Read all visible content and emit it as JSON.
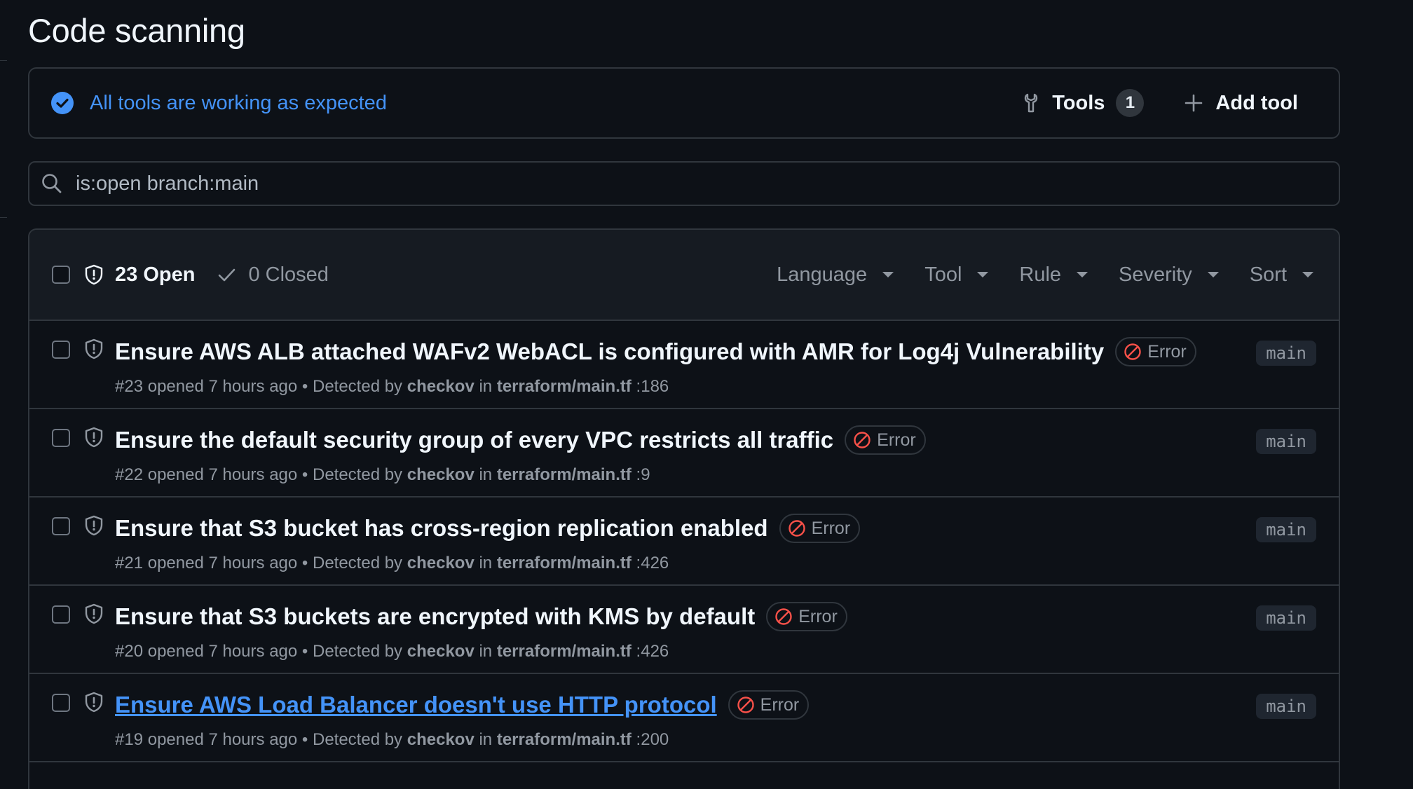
{
  "page": {
    "title": "Code scanning"
  },
  "status": {
    "message": "All tools are working as expected",
    "tools_label": "Tools",
    "tools_count": "1",
    "add_tool_label": "Add tool"
  },
  "search": {
    "value": "is:open branch:main"
  },
  "list_header": {
    "open_label": "23 Open",
    "closed_label": "0 Closed",
    "filters": [
      "Language",
      "Tool",
      "Rule",
      "Severity",
      "Sort"
    ]
  },
  "alerts": [
    {
      "title": "Ensure AWS ALB attached WAFv2 WebACL is configured with AMR for Log4j Vulnerability",
      "severity": "Error",
      "number": "#23",
      "opened": "opened 7 hours ago",
      "separator": "•",
      "detected_prefix": "Detected by",
      "tool": "checkov",
      "in_label": "in",
      "file": "terraform/main.tf",
      "line": ":186",
      "branch": "main"
    },
    {
      "title": "Ensure the default security group of every VPC restricts all traffic",
      "severity": "Error",
      "number": "#22",
      "opened": "opened 7 hours ago",
      "separator": "•",
      "detected_prefix": "Detected by",
      "tool": "checkov",
      "in_label": "in",
      "file": "terraform/main.tf",
      "line": ":9",
      "branch": "main"
    },
    {
      "title": "Ensure that S3 bucket has cross-region replication enabled",
      "severity": "Error",
      "number": "#21",
      "opened": "opened 7 hours ago",
      "separator": "•",
      "detected_prefix": "Detected by",
      "tool": "checkov",
      "in_label": "in",
      "file": "terraform/main.tf",
      "line": ":426",
      "branch": "main"
    },
    {
      "title": "Ensure that S3 buckets are encrypted with KMS by default",
      "severity": "Error",
      "number": "#20",
      "opened": "opened 7 hours ago",
      "separator": "•",
      "detected_prefix": "Detected by",
      "tool": "checkov",
      "in_label": "in",
      "file": "terraform/main.tf",
      "line": ":426",
      "branch": "main"
    },
    {
      "title": "Ensure AWS Load Balancer doesn't use HTTP protocol",
      "severity": "Error",
      "number": "#19",
      "opened": "opened 7 hours ago",
      "separator": "•",
      "detected_prefix": "Detected by",
      "tool": "checkov",
      "in_label": "in",
      "file": "terraform/main.tf",
      "line": ":200",
      "branch": "main"
    }
  ],
  "colors": {
    "background": "#0d1117",
    "border": "#30363d",
    "accent_blue": "#4493f8",
    "error_red": "#f85149",
    "muted_text": "#9198a1"
  },
  "icons": {
    "status": "check-circle-icon",
    "tools": "tools-icon",
    "add": "plus-icon",
    "search": "search-icon",
    "open": "shield-icon",
    "closed": "check-icon",
    "severity": "stop-icon"
  }
}
